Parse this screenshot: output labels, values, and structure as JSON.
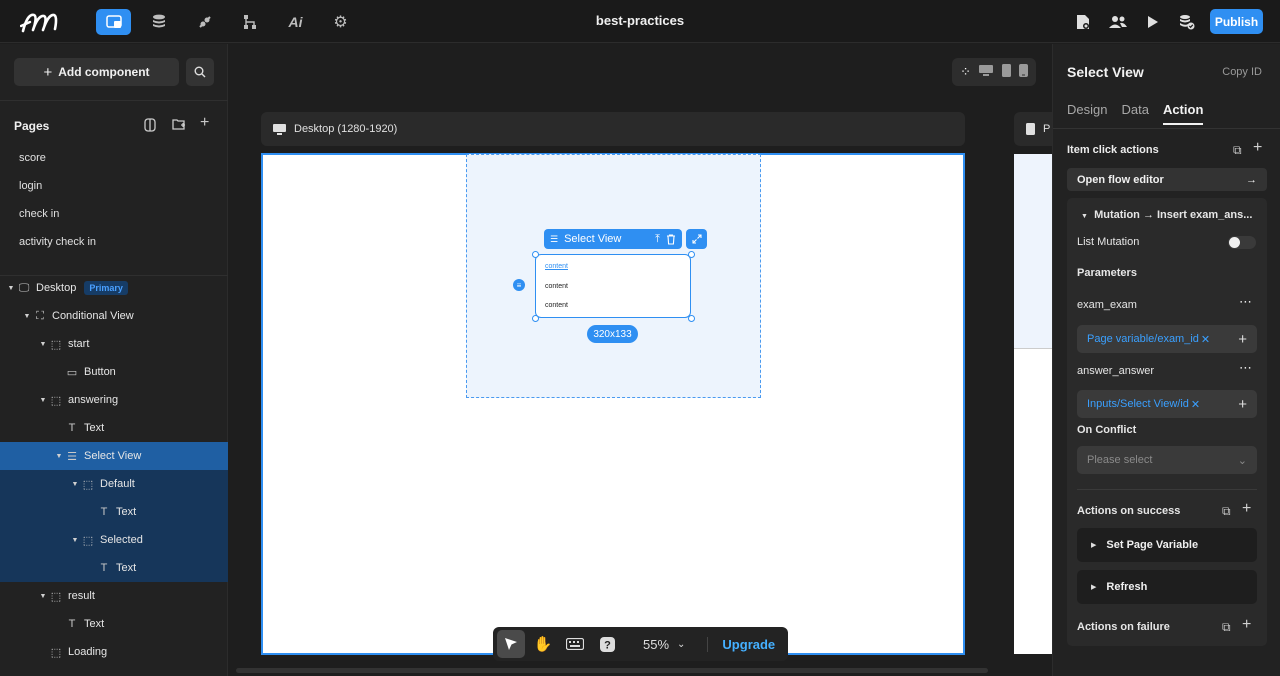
{
  "topbar": {
    "title": "best-practices",
    "publish_label": "Publish",
    "left_icons": [
      "layout-icon",
      "database-icon",
      "api-icon",
      "flow-icon",
      "ai-icon",
      "settings-icon"
    ],
    "right_icons": [
      "file-settings-icon",
      "users-icon",
      "preview-icon",
      "database-check-icon"
    ],
    "accent_color": "#2f8ff2"
  },
  "left_panel": {
    "add_component_label": "Add component",
    "pages_title": "Pages",
    "pages": [
      "score",
      "login",
      "check in",
      "activity check in"
    ],
    "tree": [
      {
        "label": "Desktop",
        "badge": "Primary"
      },
      {
        "label": "Conditional View"
      },
      {
        "label": "start"
      },
      {
        "label": "Button"
      },
      {
        "label": "answering"
      },
      {
        "label": "Text"
      },
      {
        "label": "Select View"
      },
      {
        "label": "Default"
      },
      {
        "label": "Text"
      },
      {
        "label": "Selected"
      },
      {
        "label": "Text"
      },
      {
        "label": "result"
      },
      {
        "label": "Text"
      },
      {
        "label": "Loading"
      }
    ]
  },
  "canvas": {
    "frame_label": "Desktop (1280-1920)",
    "frame2_label": "P",
    "selected_component": "Select View",
    "list_items": [
      "content",
      "content",
      "content"
    ],
    "size_label": "320x133",
    "zoom": "55%",
    "upgrade_label": "Upgrade"
  },
  "right_panel": {
    "title": "Select View",
    "copy_id": "Copy ID",
    "tabs": [
      "Design",
      "Data",
      "Action"
    ],
    "active_tab": "Action",
    "item_click_actions": "Item click actions",
    "open_flow_editor": "Open flow editor",
    "mutation_title": "Mutation → Insert exam_ans...",
    "list_mutation": "List Mutation",
    "parameters": "Parameters",
    "param1_name": "exam_exam",
    "param1_value": "Page variable/exam_id",
    "param2_name": "answer_answer",
    "param2_value": "Inputs/Select View/id",
    "on_conflict": "On Conflict",
    "please_select": "Please select",
    "actions_on_success": "Actions on success",
    "success_actions": [
      "Set Page Variable",
      "Refresh"
    ],
    "actions_on_failure": "Actions on failure"
  }
}
